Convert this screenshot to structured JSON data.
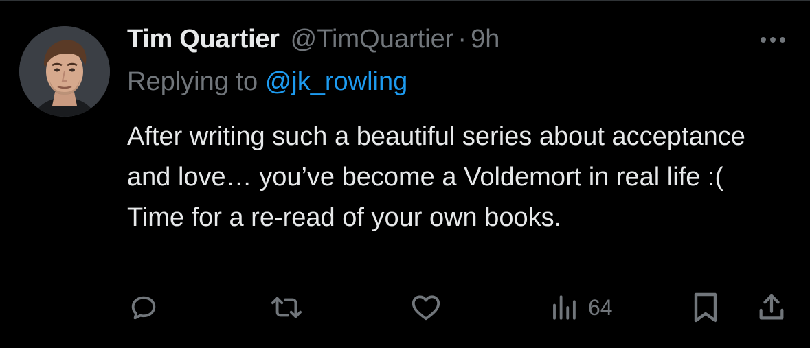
{
  "tweet": {
    "display_name": "Tim Quartier",
    "handle": "@TimQuartier",
    "separator": "·",
    "time": "9h",
    "replying_prefix": "Replying to",
    "replying_to": "@jk_rowling",
    "text": "After writing such a beautiful series about acceptance and love… you’ve become a Voldemort in real life :( Time for a re-read of your own books."
  },
  "actions": {
    "views_count": "64"
  },
  "icons": {
    "more": "more-horizontal-icon",
    "reply": "reply-icon",
    "retweet": "retweet-icon",
    "like": "heart-icon",
    "views": "views-icon",
    "bookmark": "bookmark-icon",
    "share": "share-icon"
  },
  "colors": {
    "background": "#000000",
    "text_primary": "#e7e9ea",
    "text_secondary": "#71767b",
    "accent": "#1d9bf0"
  }
}
